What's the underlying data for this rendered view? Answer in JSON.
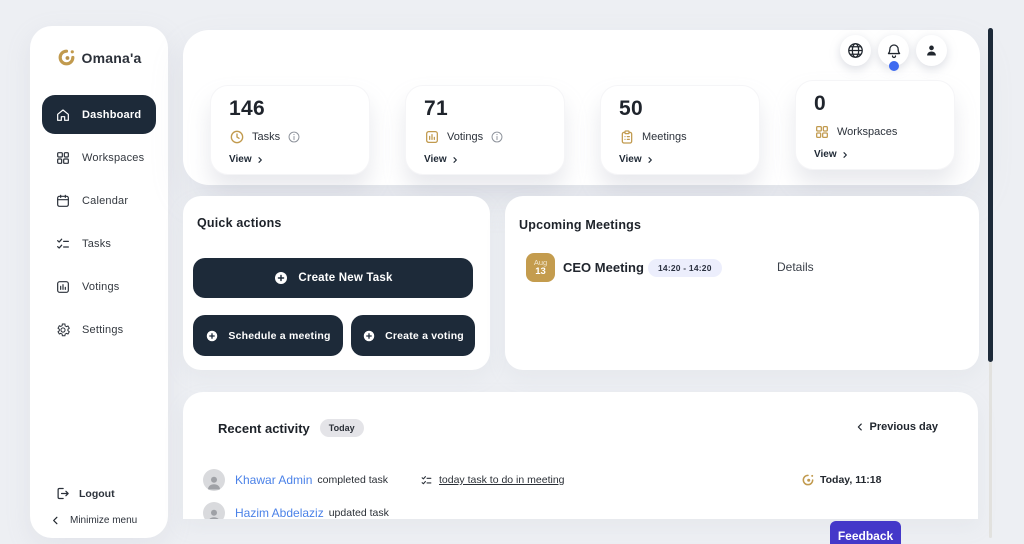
{
  "brand": "Omana'a",
  "colors": {
    "navy": "#1d2a39",
    "gold": "#c19a4e",
    "link_blue": "#4b82e8",
    "notification_blue": "#3e6af0",
    "feedback_indigo": "#4438c9",
    "time_pill_bg": "#eceefc",
    "page_bg": "#edeff3"
  },
  "sidebar": {
    "items": [
      {
        "label": "Dashboard",
        "icon": "home-icon",
        "active": true
      },
      {
        "label": "Workspaces",
        "icon": "workspaces-icon",
        "active": false
      },
      {
        "label": "Calendar",
        "icon": "calendar-icon",
        "active": false
      },
      {
        "label": "Tasks",
        "icon": "tasks-icon",
        "active": false
      },
      {
        "label": "Votings",
        "icon": "votings-icon",
        "active": false
      },
      {
        "label": "Settings",
        "icon": "settings-icon",
        "active": false
      }
    ],
    "logout": "Logout",
    "minimize": "Minimize menu"
  },
  "header": {
    "icons": [
      "globe-icon",
      "bell-icon",
      "user-icon"
    ],
    "bell_has_notification": true
  },
  "stats": [
    {
      "value": "146",
      "label": "Tasks",
      "icon": "clock-icon",
      "has_info": true,
      "view": "View"
    },
    {
      "value": "71",
      "label": "Votings",
      "icon": "bar-chart-icon",
      "has_info": true,
      "view": "View"
    },
    {
      "value": "50",
      "label": "Meetings",
      "icon": "clipboard-icon",
      "has_info": false,
      "view": "View"
    },
    {
      "value": "0",
      "label": "Workspaces",
      "icon": "grid-icon",
      "has_info": false,
      "view": "View"
    }
  ],
  "quick_actions": {
    "title": "Quick actions",
    "primary": "Create New Task",
    "schedule": "Schedule a meeting",
    "voting": "Create a voting"
  },
  "upcoming": {
    "title": "Upcoming Meetings",
    "meeting": {
      "month": "Aug",
      "day": "13",
      "title": "CEO Meeting",
      "time": "14:20 - 14:20",
      "details": "Details"
    }
  },
  "activity": {
    "title": "Recent activity",
    "badge": "Today",
    "previous": "Previous day",
    "rows": [
      {
        "user": "Khawar Admin",
        "action": "completed task",
        "task": "today task to do in meeting",
        "time": "Today, 11:18"
      },
      {
        "user": "Hazim Abdelaziz",
        "action": "updated task",
        "task": "",
        "time": ""
      }
    ]
  },
  "feedback": "Feedback"
}
